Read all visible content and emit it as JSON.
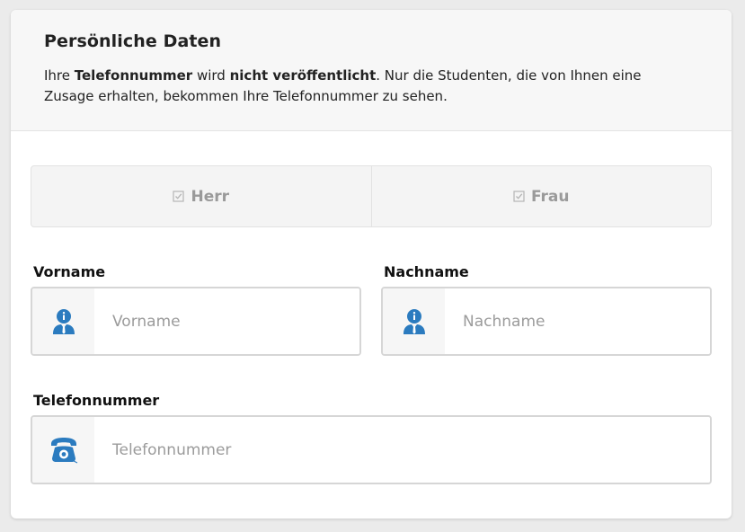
{
  "header": {
    "title": "Persönliche Daten",
    "desc_1": "Ihre ",
    "desc_bold_1": "Telefonnummer",
    "desc_2": " wird ",
    "desc_bold_2": "nicht veröffentlicht",
    "desc_3": ". Nur die Studenten, die von Ihnen eine Zusage erhalten, bekommen Ihre Telefonnummer zu sehen."
  },
  "gender": {
    "options": [
      {
        "label": "Herr",
        "icon": "checkbox-icon"
      },
      {
        "label": "Frau",
        "icon": "checkbox-icon"
      }
    ]
  },
  "fields": {
    "vorname": {
      "label": "Vorname",
      "placeholder": "Vorname",
      "value": "",
      "icon": "person-info-icon"
    },
    "nachname": {
      "label": "Nachname",
      "placeholder": "Nachname",
      "value": "",
      "icon": "person-info-icon"
    },
    "telefon": {
      "label": "Telefonnummer",
      "placeholder": "Telefonnummer",
      "value": "",
      "icon": "telephone-icon"
    }
  },
  "colors": {
    "accent_icon": "#2b7bbf",
    "header_bg": "#f7f7f7",
    "page_bg": "#ebebeb"
  }
}
